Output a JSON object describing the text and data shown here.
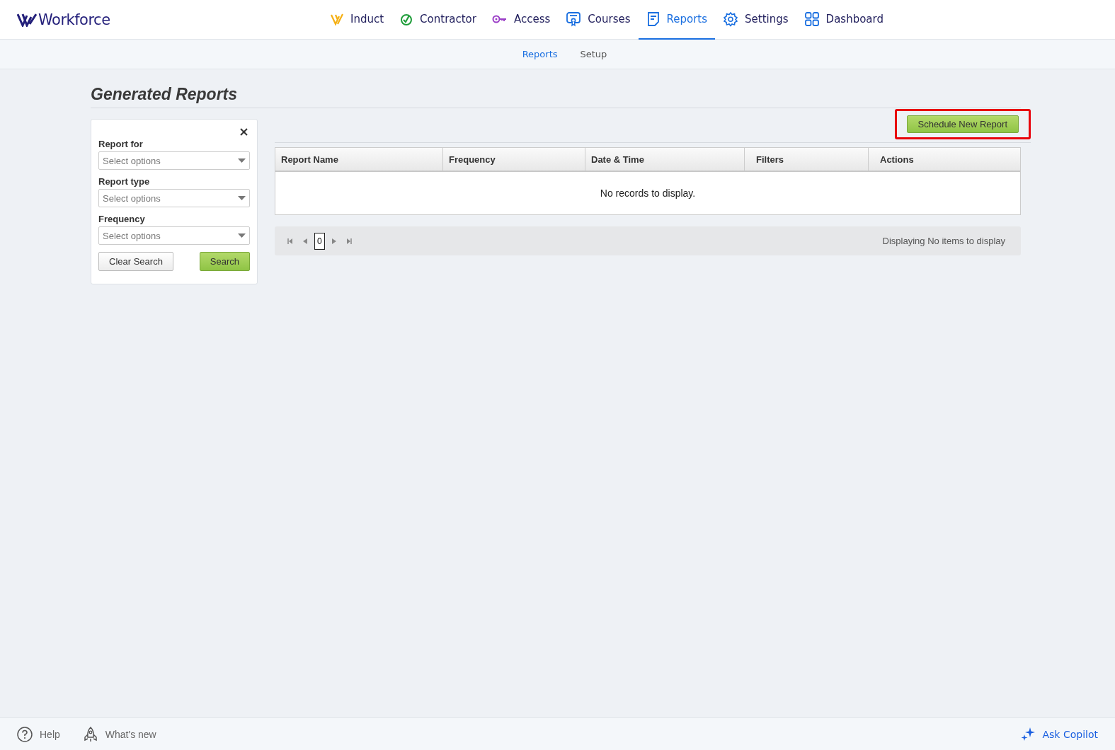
{
  "brand": "Workforce",
  "nav": [
    {
      "label": "Induct",
      "kind": "induct",
      "selected": false
    },
    {
      "label": "Contractor",
      "kind": "contractor",
      "selected": false
    },
    {
      "label": "Access",
      "kind": "access",
      "selected": false
    },
    {
      "label": "Courses",
      "kind": "courses",
      "selected": false
    },
    {
      "label": "Reports",
      "kind": "reports",
      "selected": true
    },
    {
      "label": "Settings",
      "kind": "settings",
      "selected": false
    },
    {
      "label": "Dashboard",
      "kind": "dashboard",
      "selected": false
    }
  ],
  "subnav": [
    {
      "label": "Reports",
      "selected": true
    },
    {
      "label": "Setup",
      "selected": false
    }
  ],
  "page_title": "Generated Reports",
  "filters": {
    "fields": [
      {
        "label": "Report for",
        "placeholder": "Select options"
      },
      {
        "label": "Report type",
        "placeholder": "Select options"
      },
      {
        "label": "Frequency",
        "placeholder": "Select options"
      }
    ],
    "clear_button": "Clear Search",
    "search_button": "Search"
  },
  "schedule_button": {
    "label": "Schedule New Report",
    "highlighted": true
  },
  "table": {
    "columns": [
      "Report Name",
      "Frequency",
      "Date & Time",
      "Filters",
      "Actions"
    ],
    "empty_message": "No records to display."
  },
  "pager": {
    "page": "0",
    "status": "Displaying No items to display"
  },
  "footer": {
    "help": "Help",
    "whats_new": "What's new",
    "copilot": "Ask Copilot"
  }
}
